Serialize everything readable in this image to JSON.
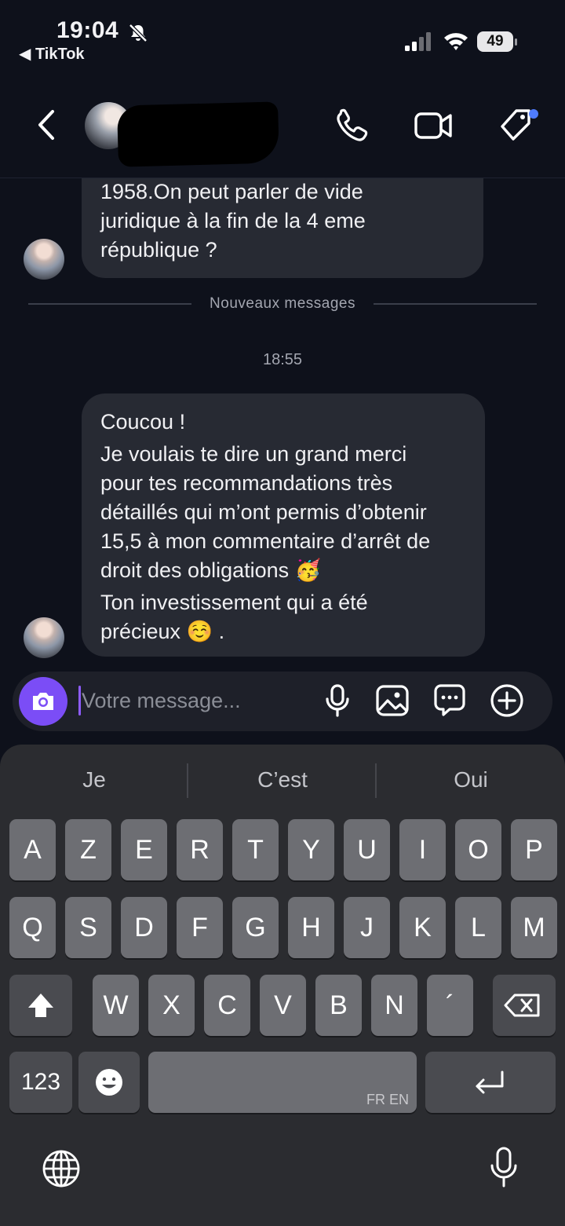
{
  "status_bar": {
    "time": "19:04",
    "back_app": "◀ TikTok",
    "battery": "49"
  },
  "header": {
    "back_icon": "chevron-left-icon",
    "call_icon": "phone-icon",
    "video_icon": "video-camera-icon",
    "tag_icon": "tag-icon",
    "tag_dot_color": "#4f7cff"
  },
  "messages": {
    "first_lines": [
      "1958.On peut parler de vide",
      "juridique à la fin de la 4 eme",
      "république ?"
    ],
    "separator_label": "Nouveaux messages",
    "timestamp": "18:55",
    "second_lines": [
      "Coucou !",
      "Je voulais te dire un grand merci",
      "pour tes recommandations très",
      "détaillés qui m’ont permis d’obtenir",
      "15,5 à mon commentaire d’arrêt de",
      "droit des obligations 🥳",
      "Ton investissement qui a été",
      "précieux ☺️ ."
    ]
  },
  "composer": {
    "placeholder": "Votre message...",
    "accent_color": "#7b4df6"
  },
  "keyboard": {
    "suggestions": [
      "Je",
      "C’est",
      "Oui"
    ],
    "row1": [
      "A",
      "Z",
      "E",
      "R",
      "T",
      "Y",
      "U",
      "I",
      "O",
      "P"
    ],
    "row2": [
      "Q",
      "S",
      "D",
      "F",
      "G",
      "H",
      "J",
      "K",
      "L",
      "M"
    ],
    "row3": [
      "W",
      "X",
      "C",
      "V",
      "B",
      "N",
      "´"
    ],
    "numbers_key": "123",
    "space_label": "FR EN"
  }
}
